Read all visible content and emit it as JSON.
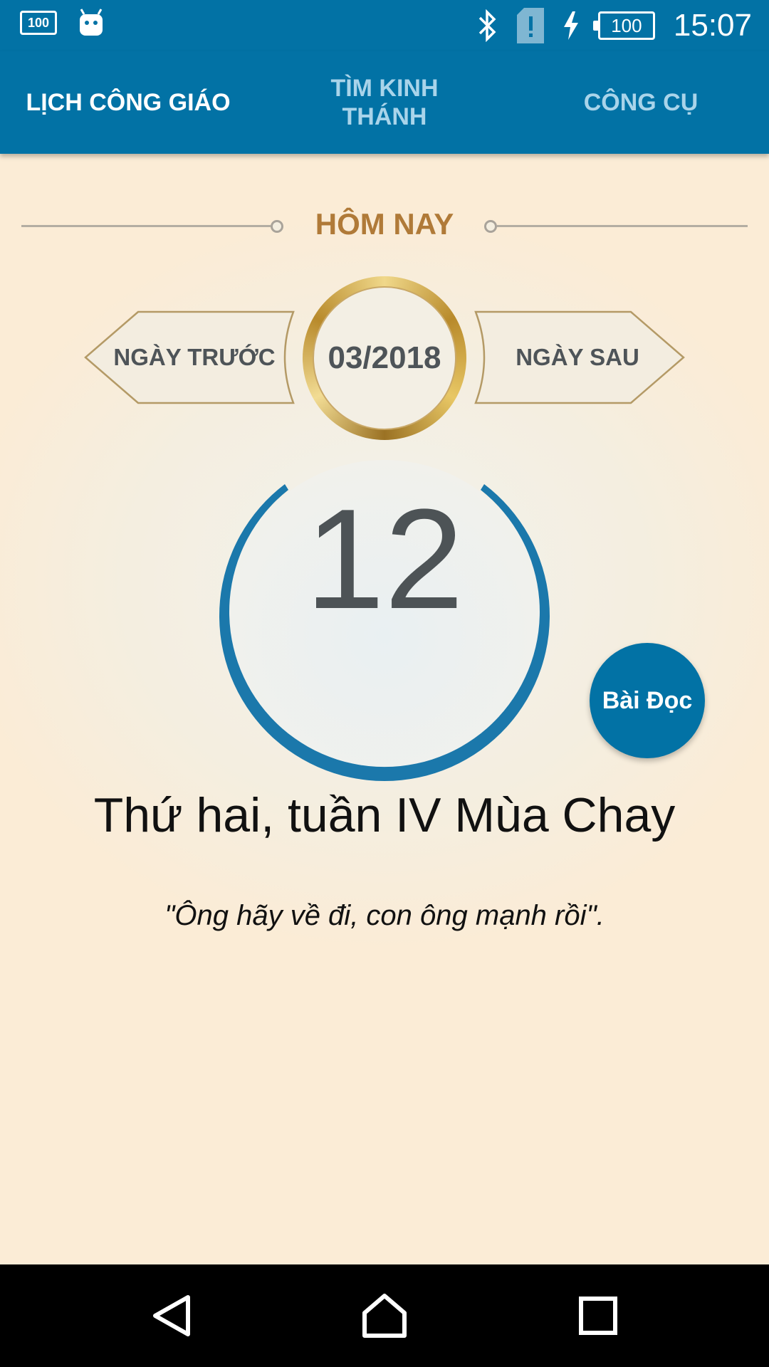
{
  "status_bar": {
    "time": "15:07",
    "battery_level": "100",
    "notification_badge": "100",
    "icons": [
      "badge-100-icon",
      "android-icon",
      "bluetooth-icon",
      "sim-alert-icon",
      "charging-icon",
      "battery-icon"
    ]
  },
  "tabs": [
    {
      "label": "LỊCH CÔNG GIÁO",
      "active": true
    },
    {
      "label": "TÌM KINH THÁNH",
      "active": false
    },
    {
      "label": "CÔNG CỤ",
      "active": false
    }
  ],
  "today": {
    "label": "HÔM NAY",
    "prev_label": "NGÀY TRƯỚC",
    "next_label": "NGÀY SAU",
    "month_year": "03/2018",
    "day": "12",
    "reading_button": "Bài Đọc",
    "liturgical_day": "Thứ hai, tuần IV Mùa Chay",
    "quote": "\"Ông hãy về đi, con ông mạnh rồi\"."
  },
  "colors": {
    "primary": "#0272a5",
    "inactive_tab": "#a9d4ea",
    "gold": "#b07a38",
    "text_dark": "#4e5458"
  },
  "nav_bar": {
    "icons": [
      "back-icon",
      "home-icon",
      "recents-icon"
    ]
  }
}
